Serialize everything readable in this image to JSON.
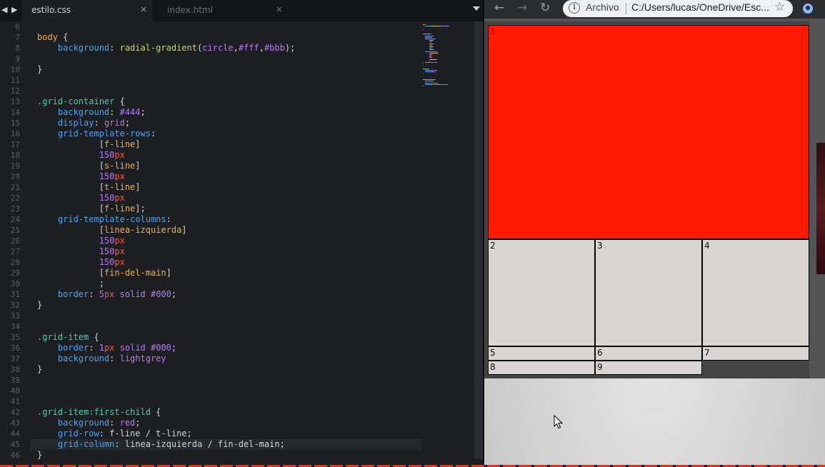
{
  "editor": {
    "tabs": [
      {
        "label": "estilo.css",
        "close": "×",
        "active": true
      },
      {
        "label": "index.html",
        "close": "×",
        "active": false
      }
    ],
    "nav_arrows": "◀ ▶",
    "code": [
      {
        "n": "6",
        "t": []
      },
      {
        "n": "7",
        "t": [
          [
            "sel",
            "body"
          ],
          [
            "pu",
            " {"
          ]
        ]
      },
      {
        "n": "8",
        "t": [
          [
            "pu",
            "    "
          ],
          [
            "prop",
            "background"
          ],
          [
            "pu",
            ": "
          ],
          [
            "fn",
            "radial-gradient"
          ],
          [
            "pu",
            "("
          ],
          [
            "kw",
            "circle"
          ],
          [
            "pu",
            ","
          ],
          [
            "hex",
            "#fff"
          ],
          [
            "pu",
            ","
          ],
          [
            "hex",
            "#bbb"
          ],
          [
            "pu",
            ");"
          ]
        ]
      },
      {
        "n": "9",
        "t": []
      },
      {
        "n": "10",
        "t": [
          [
            "pu",
            "}"
          ]
        ]
      },
      {
        "n": "11",
        "t": []
      },
      {
        "n": "12",
        "t": []
      },
      {
        "n": "13",
        "t": [
          [
            "cls",
            ".grid-container"
          ],
          [
            "pu",
            " {"
          ]
        ]
      },
      {
        "n": "14",
        "t": [
          [
            "pu",
            "    "
          ],
          [
            "prop",
            "background"
          ],
          [
            "pu",
            ": "
          ],
          [
            "hex",
            "#444"
          ],
          [
            "pu",
            ";"
          ]
        ]
      },
      {
        "n": "15",
        "t": [
          [
            "pu",
            "    "
          ],
          [
            "prop",
            "display"
          ],
          [
            "pu",
            ": "
          ],
          [
            "kw",
            "grid"
          ],
          [
            "pu",
            ";"
          ]
        ]
      },
      {
        "n": "16",
        "t": [
          [
            "pu",
            "    "
          ],
          [
            "prop",
            "grid-template-rows"
          ],
          [
            "pu",
            ":"
          ]
        ]
      },
      {
        "n": "17",
        "t": [
          [
            "pu",
            "            ["
          ],
          [
            "nm",
            "f-line"
          ],
          [
            "pu",
            "]"
          ]
        ]
      },
      {
        "n": "18",
        "t": [
          [
            "pu",
            "            "
          ],
          [
            "num",
            "150"
          ],
          [
            "unit",
            "px"
          ]
        ]
      },
      {
        "n": "19",
        "t": [
          [
            "pu",
            "            ["
          ],
          [
            "nm",
            "s-line"
          ],
          [
            "pu",
            "]"
          ]
        ]
      },
      {
        "n": "20",
        "t": [
          [
            "pu",
            "            "
          ],
          [
            "num",
            "150"
          ],
          [
            "unit",
            "px"
          ]
        ]
      },
      {
        "n": "21",
        "t": [
          [
            "pu",
            "            ["
          ],
          [
            "nm",
            "t-line"
          ],
          [
            "pu",
            "]"
          ]
        ]
      },
      {
        "n": "22",
        "t": [
          [
            "pu",
            "            "
          ],
          [
            "num",
            "150"
          ],
          [
            "unit",
            "px"
          ]
        ]
      },
      {
        "n": "23",
        "t": [
          [
            "pu",
            "            ["
          ],
          [
            "nm",
            "f-line"
          ],
          [
            "pu",
            "];"
          ]
        ]
      },
      {
        "n": "24",
        "t": [
          [
            "pu",
            "    "
          ],
          [
            "prop",
            "grid-template-columns"
          ],
          [
            "pu",
            ":"
          ]
        ]
      },
      {
        "n": "25",
        "t": [
          [
            "pu",
            "            ["
          ],
          [
            "nm",
            "linea-izquierda"
          ],
          [
            "pu",
            "]"
          ]
        ]
      },
      {
        "n": "26",
        "t": [
          [
            "pu",
            "            "
          ],
          [
            "num",
            "150"
          ],
          [
            "unit",
            "px"
          ]
        ]
      },
      {
        "n": "27",
        "t": [
          [
            "pu",
            "            "
          ],
          [
            "num",
            "150"
          ],
          [
            "unit",
            "px"
          ]
        ]
      },
      {
        "n": "28",
        "t": [
          [
            "pu",
            "            "
          ],
          [
            "num",
            "150"
          ],
          [
            "unit",
            "px"
          ]
        ]
      },
      {
        "n": "29",
        "t": [
          [
            "pu",
            "            ["
          ],
          [
            "nm",
            "fin-del-main"
          ],
          [
            "pu",
            "]"
          ]
        ]
      },
      {
        "n": "30",
        "t": [
          [
            "pu",
            "            ;"
          ]
        ]
      },
      {
        "n": "31",
        "t": [
          [
            "pu",
            "    "
          ],
          [
            "prop",
            "border"
          ],
          [
            "pu",
            ": "
          ],
          [
            "num",
            "5"
          ],
          [
            "unit",
            "px"
          ],
          [
            "pu",
            " "
          ],
          [
            "kw",
            "solid"
          ],
          [
            "pu",
            " "
          ],
          [
            "hex",
            "#000"
          ],
          [
            "pu",
            ";"
          ]
        ]
      },
      {
        "n": "32",
        "t": [
          [
            "pu",
            "}"
          ]
        ]
      },
      {
        "n": "33",
        "t": []
      },
      {
        "n": "34",
        "t": []
      },
      {
        "n": "35",
        "t": [
          [
            "cls",
            ".grid-item"
          ],
          [
            "pu",
            " {"
          ]
        ]
      },
      {
        "n": "36",
        "t": [
          [
            "pu",
            "    "
          ],
          [
            "prop",
            "border"
          ],
          [
            "pu",
            ": "
          ],
          [
            "num",
            "1"
          ],
          [
            "unit",
            "px"
          ],
          [
            "pu",
            " "
          ],
          [
            "kw",
            "solid"
          ],
          [
            "pu",
            " "
          ],
          [
            "hex",
            "#000"
          ],
          [
            "pu",
            ";"
          ]
        ]
      },
      {
        "n": "37",
        "t": [
          [
            "pu",
            "    "
          ],
          [
            "prop",
            "background"
          ],
          [
            "pu",
            ": "
          ],
          [
            "kw",
            "lightgrey"
          ]
        ]
      },
      {
        "n": "38",
        "t": [
          [
            "pu",
            "}"
          ]
        ]
      },
      {
        "n": "39",
        "t": []
      },
      {
        "n": "40",
        "t": []
      },
      {
        "n": "41",
        "t": []
      },
      {
        "n": "42",
        "t": [
          [
            "cls",
            ".grid-item:first-child"
          ],
          [
            "pu",
            " {"
          ]
        ]
      },
      {
        "n": "43",
        "t": [
          [
            "pu",
            "    "
          ],
          [
            "prop",
            "background"
          ],
          [
            "pu",
            ": "
          ],
          [
            "kw",
            "red"
          ],
          [
            "pu",
            ";"
          ]
        ]
      },
      {
        "n": "44",
        "t": [
          [
            "pu",
            "    "
          ],
          [
            "prop",
            "grid-row"
          ],
          [
            "pu",
            ": "
          ],
          [
            "pu",
            "f-line / t-line;"
          ]
        ]
      },
      {
        "n": "45",
        "t": [
          [
            "pu",
            "    "
          ],
          [
            "prop",
            "grid-column"
          ],
          [
            "pu",
            ": "
          ],
          [
            "pu",
            "linea-izquierda / fin-del-main;"
          ]
        ]
      },
      {
        "n": "46",
        "t": [
          [
            "pu",
            "}"
          ]
        ]
      }
    ]
  },
  "browser": {
    "back_icon": "←",
    "forward_icon": "→",
    "reload_icon": "↻",
    "info_icon": "i",
    "scheme_label": "Archivo",
    "url": "C:/Users/lucas/OneDrive/Esc...",
    "star_icon": "☆",
    "grid_items": [
      "1",
      "2",
      "3",
      "4",
      "5",
      "6",
      "7",
      "8",
      "9"
    ],
    "colors": {
      "item1": "#ff1a00",
      "item": "#d8d5d3",
      "container": "#444"
    }
  }
}
